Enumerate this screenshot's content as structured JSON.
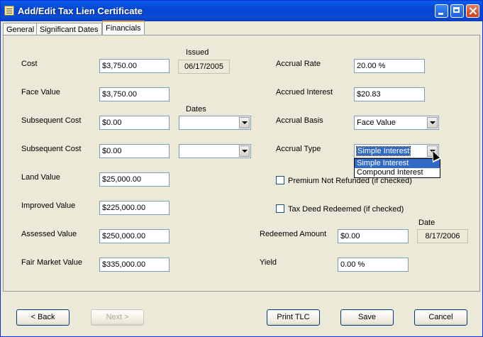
{
  "window": {
    "title": "Add/Edit Tax Lien Certificate"
  },
  "tabs": [
    {
      "label": "General"
    },
    {
      "label": "Significant Dates"
    },
    {
      "label": "Financials"
    }
  ],
  "left": {
    "issued_label": "Issued",
    "issued_value": "06/17/2005",
    "dates_label": "Dates",
    "fields": [
      {
        "label": "Cost",
        "value": "$3,750.00"
      },
      {
        "label": "Face Value",
        "value": "$3,750.00"
      },
      {
        "label": "Subsequent Cost",
        "value": "$0.00"
      },
      {
        "label": "Subsequent Cost",
        "value": "$0.00"
      },
      {
        "label": "Land Value",
        "value": "$25,000.00"
      },
      {
        "label": "Improved Value",
        "value": "$225,000.00"
      },
      {
        "label": "Assessed Value",
        "value": "$250,000.00"
      },
      {
        "label": "Fair Market Value",
        "value": "$335,000.00"
      }
    ],
    "date_combo_1": "",
    "date_combo_2": ""
  },
  "right": {
    "accrual_rate_label": "Accrual Rate",
    "accrual_rate_value": "20.00 %",
    "accrued_interest_label": "Accrued Interest",
    "accrued_interest_value": "$20.83",
    "accrual_basis_label": "Accrual Basis",
    "accrual_basis_value": "Face Value",
    "accrual_type_label": "Accrual Type",
    "accrual_type_value": "Simple Interest",
    "accrual_type_options": [
      "Simple Interest",
      "Compound Interest"
    ],
    "premium_label": "Premium Not Refunded (if checked)",
    "premium_checked": false,
    "tax_deed_label": "Tax Deed Redeemed (if checked)",
    "tax_deed_checked": false,
    "redeemed_amount_label": "Redeemed Amount",
    "redeemed_amount_value": "$0.00",
    "date_label": "Date",
    "date_value": "8/17/2006",
    "yield_label": "Yield",
    "yield_value": "0.00 %"
  },
  "buttons": {
    "back": "< Back",
    "next": "Next >",
    "print": "Print TLC",
    "save": "Save",
    "cancel": "Cancel"
  },
  "colors": {
    "titlebar": "#0a5ce8",
    "face": "#ece9d8",
    "selection": "#316ac5"
  },
  "icons": [
    "app-icon",
    "minimize-icon",
    "maximize-icon",
    "close-icon",
    "chevron-down-icon",
    "cursor-icon"
  ]
}
